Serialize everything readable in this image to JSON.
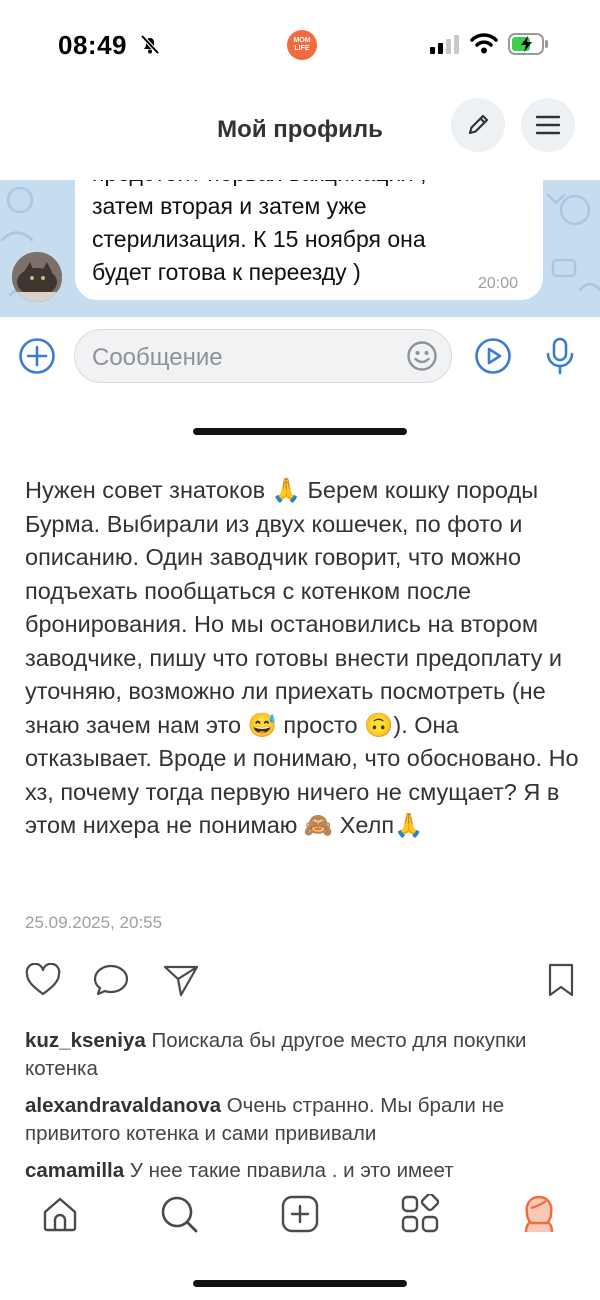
{
  "status_bar": {
    "time": "08:49",
    "app_logo_text": "MOM LIFE"
  },
  "header": {
    "title": "Мой профиль"
  },
  "chat_screenshot": {
    "lines": [
      "предстоит первая вакцинация ,",
      "затем вторая и затем уже",
      "стерилизация. К 15 ноября она",
      "будет готова к переезду )"
    ],
    "time": "20:00"
  },
  "message_input": {
    "placeholder": "Сообщение"
  },
  "post": {
    "text": "Нужен совет знатоков 🙏 Берем кошку породы Бурма. Выбирали из двух кошечек, по фото и описанию. Один заводчик говорит, что можно подъехать пообщаться с котенком после бронирования. Но мы остановились на втором заводчике, пишу что готовы внести предоплату и уточняю, возможно ли приехать посмотреть (не знаю зачем нам это 😅 просто 🙃). Она отказывает. Вроде и понимаю, что обосновано. Но хз, почему тогда первую ничего не смущает? Я в этом нихера не понимаю 🙈 Хелп🙏",
    "date": "25.09.2025, 20:55"
  },
  "comments": [
    {
      "user": "kuz_kseniya",
      "text": "Поискала бы другое место для покупки котенка"
    },
    {
      "user": "alexandravaldanova",
      "text": "Очень странно. Мы брали не привитого котенка и сами прививали"
    },
    {
      "user": "camamilla",
      "text": "У нее такие правила , и это имеет"
    }
  ],
  "colors": {
    "accent": "#3a7bd5",
    "profile_orange": "#f26a3d",
    "chat_bg": "#c6dcef"
  },
  "icons": [
    "bell-slash-icon",
    "signal-icon",
    "wifi-icon",
    "battery-charging-icon",
    "pencil-icon",
    "menu-icon",
    "add-circle-icon",
    "emoji-icon",
    "play-circle-icon",
    "microphone-icon",
    "heart-icon",
    "comment-icon",
    "send-icon",
    "bookmark-icon",
    "home-icon",
    "search-icon",
    "plus-square-icon",
    "apps-icon",
    "profile-avatar-icon"
  ]
}
